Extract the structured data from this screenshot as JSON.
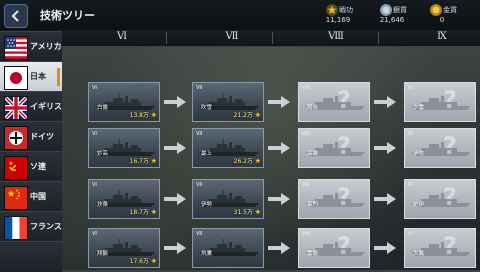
{
  "header": {
    "title": "技術ツリー",
    "resources": [
      {
        "label": "戦功",
        "value": "11,169",
        "icon": "merit-star-icon",
        "color": "#c9a227"
      },
      {
        "label": "銀貨",
        "value": "21,646",
        "icon": "silver-coin-icon",
        "color": "#9fb4c8"
      },
      {
        "label": "金貨",
        "value": "0",
        "icon": "gold-coin-icon",
        "color": "#e3b21a"
      }
    ]
  },
  "tiers": [
    "Ⅵ",
    "Ⅶ",
    "Ⅷ",
    "Ⅸ"
  ],
  "nations": [
    {
      "name": "アメリカ",
      "flag": "usa",
      "active": false
    },
    {
      "name": "日本",
      "flag": "japan",
      "active": true
    },
    {
      "name": "イギリス",
      "flag": "uk",
      "active": false
    },
    {
      "name": "ドイツ",
      "flag": "germany",
      "active": false
    },
    {
      "name": "ソ連",
      "flag": "ussr",
      "active": false
    },
    {
      "name": "中国",
      "flag": "china",
      "active": false
    },
    {
      "name": "フランス",
      "flag": "france",
      "active": false
    }
  ],
  "rows": [
    [
      {
        "tag": "VI",
        "name": "白露",
        "cost": "13.8万",
        "locked": false
      },
      {
        "tag": "VII",
        "name": "吹雪",
        "cost": "21.2万",
        "locked": false
      },
      {
        "tag": "VIII",
        "name": "陽炎",
        "cost": "",
        "locked": true
      },
      {
        "tag": "IX",
        "name": "夕雲",
        "cost": "",
        "locked": true
      }
    ],
    [
      {
        "tag": "VI",
        "name": "妙高",
        "cost": "16.7万",
        "locked": false
      },
      {
        "tag": "VII",
        "name": "最上",
        "cost": "26.2万",
        "locked": false
      },
      {
        "tag": "VIII",
        "name": "高雄",
        "cost": "",
        "locked": true
      },
      {
        "tag": "IX",
        "name": "伊吹",
        "cost": "",
        "locked": true
      }
    ],
    [
      {
        "tag": "VI",
        "name": "扶桑",
        "cost": "18.7万",
        "locked": false
      },
      {
        "tag": "VII",
        "name": "伊勢",
        "cost": "31.5万",
        "locked": false
      },
      {
        "tag": "VIII",
        "name": "長門",
        "cost": "",
        "locked": true
      },
      {
        "tag": "IX",
        "name": "紀伊",
        "cost": "",
        "locked": true
      }
    ],
    [
      {
        "tag": "VI",
        "name": "翔鶴",
        "cost": "17.6万",
        "locked": false
      },
      {
        "tag": "VII",
        "name": "飛鷹",
        "cost": "",
        "locked": false
      },
      {
        "tag": "VIII",
        "name": "雲龍",
        "cost": "",
        "locked": true
      },
      {
        "tag": "IX",
        "name": "大鳳",
        "cost": "",
        "locked": true
      }
    ]
  ]
}
